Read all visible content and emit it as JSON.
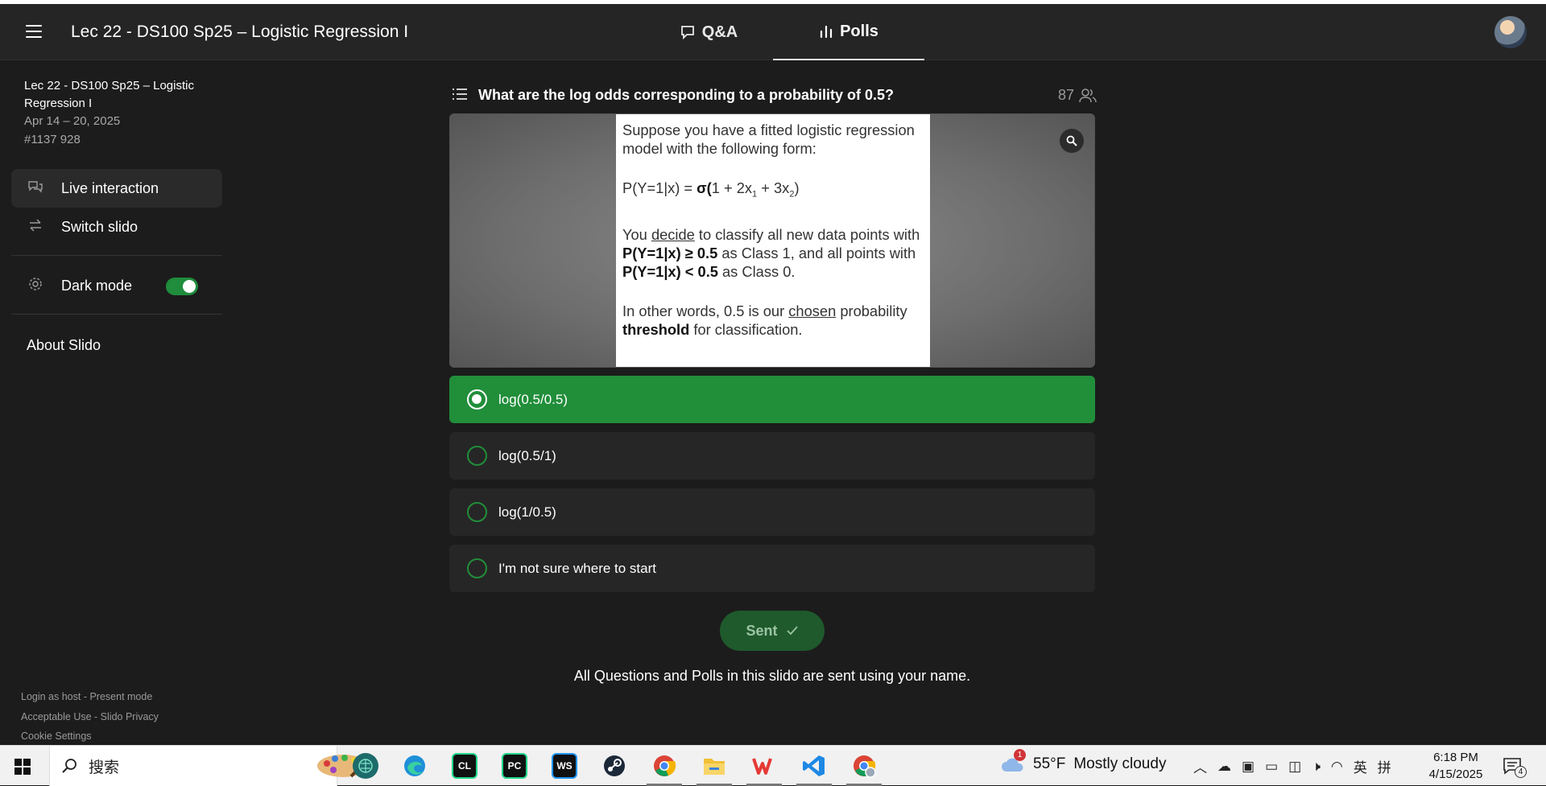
{
  "header": {
    "event_title": "Lec 22 - DS100 Sp25 – Logistic Regression I",
    "tabs": [
      {
        "label": "Q&A",
        "icon": "speech-bubble-icon",
        "active": false
      },
      {
        "label": "Polls",
        "icon": "bar-chart-icon",
        "active": true
      }
    ]
  },
  "sidebar": {
    "title": "Lec 22 - DS100 Sp25 – Logistic Regression I",
    "date": "Apr 14 – 20, 2025",
    "code": "#1137 928",
    "live_label": "Live interaction",
    "switch_label": "Switch slido",
    "dark_mode_label": "Dark mode",
    "dark_mode_on": true,
    "about_label": "About Slido",
    "links": {
      "login": "Login as host",
      "present": "Present mode",
      "acceptable": "Acceptable Use",
      "privacy": "Slido Privacy",
      "cookie": "Cookie Settings"
    }
  },
  "poll": {
    "question": "What are the log odds corresponding to a probability of 0.5?",
    "participants": "87",
    "slide": {
      "p1": "Suppose you have a fitted logistic regression model with the following form:",
      "formula_lhs": "P(Y=1|x) = ",
      "formula_sigma": "σ(",
      "formula_a": "1 + 2x",
      "formula_sub1": "1",
      "formula_b": " + 3x",
      "formula_sub2": "2",
      "formula_close": ")",
      "p3_a": "You ",
      "p3_decide": "decide",
      "p3_b": " to classify all new data points with ",
      "p3_bold1": "P(Y=1|x) ≥ 0.5",
      "p3_c": " as Class 1, and all points with ",
      "p3_bold2": "P(Y=1|x) < 0.5",
      "p3_d": " as Class 0.",
      "p4_a": "In other words, 0.5 is our ",
      "p4_chosen": "chosen",
      "p4_b": " probability ",
      "p4_threshold": "threshold",
      "p4_c": " for classification."
    },
    "options": [
      {
        "label": "log(0.5/0.5)",
        "selected": true
      },
      {
        "label": "log(0.5/1)",
        "selected": false
      },
      {
        "label": "log(1/0.5)",
        "selected": false
      },
      {
        "label": "I'm not sure where to start",
        "selected": false
      }
    ],
    "sent_label": "Sent",
    "notice": "All Questions and Polls in this slido are sent using your name."
  },
  "taskbar": {
    "search_placeholder": "搜索",
    "weather_temp": "55°F",
    "weather_desc": "Mostly cloudy",
    "weather_badge": "1",
    "lang": "英",
    "ime": "拼",
    "time": "6:18 PM",
    "date": "4/15/2025",
    "notification_count": "4",
    "apps": [
      "brain-icon",
      "edge-icon",
      "clion-icon",
      "pycharm-icon",
      "webstorm-icon",
      "steam-icon",
      "chrome-icon",
      "file-explorer-icon",
      "wps-icon",
      "vscode-icon",
      "chrome-profile-icon"
    ]
  },
  "colors": {
    "accent_green": "#218e3a",
    "background": "#1c1c1c",
    "panel": "#262626"
  }
}
